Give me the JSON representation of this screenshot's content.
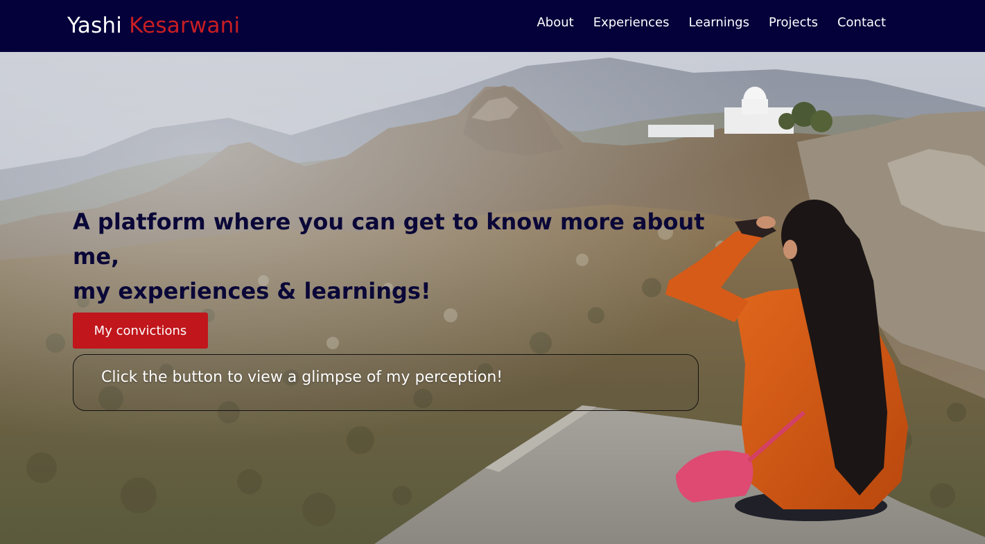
{
  "header": {
    "brand_first": "Yashi",
    "brand_last": "Kesarwani",
    "nav": [
      {
        "label": "About"
      },
      {
        "label": "Experiences"
      },
      {
        "label": "Learnings"
      },
      {
        "label": "Projects"
      },
      {
        "label": "Contact"
      }
    ]
  },
  "hero": {
    "headline_line1": "A platform where you can get to know more about me,",
    "headline_line2": "my experiences & learnings!",
    "button_label": "My convictions",
    "glimpse_text": "Click the button to view a glimpse of my perception!",
    "background_image": "mountain-landscape-photo"
  },
  "colors": {
    "navbar_bg": "#03003a",
    "brand_accent": "#c81e23",
    "button_bg": "#c0161c",
    "headline": "#0a0738"
  }
}
